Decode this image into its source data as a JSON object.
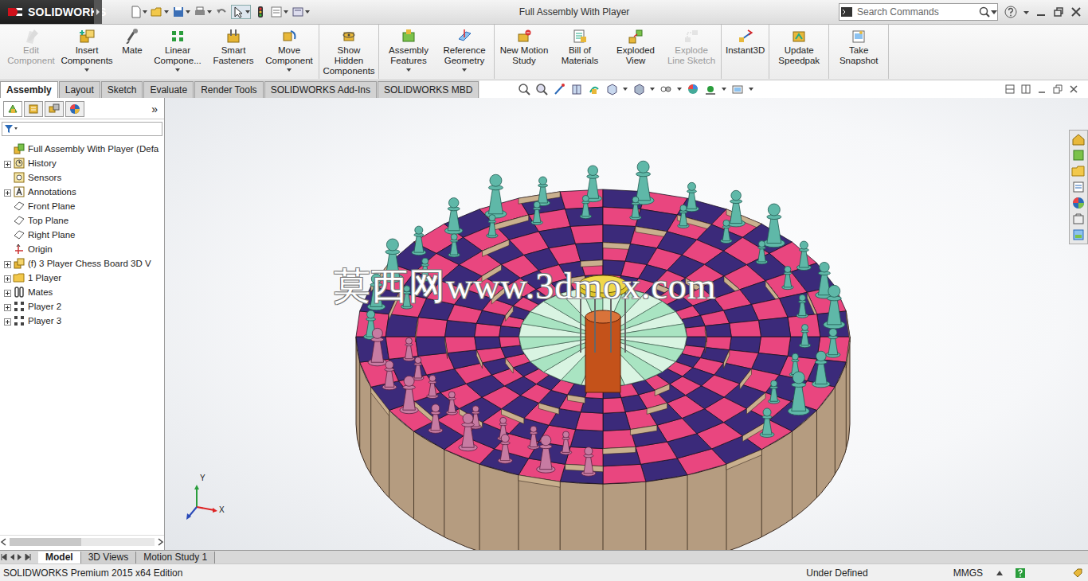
{
  "app": {
    "logo": "SOLIDWORKS",
    "title": "Full Assembly With Player"
  },
  "search": {
    "placeholder": "Search Commands"
  },
  "command_groups": [
    [
      {
        "label": "Edit Component",
        "disabled": true,
        "menu": false
      },
      {
        "label": "Insert Components",
        "disabled": false,
        "menu": true
      },
      {
        "label": "Mate",
        "disabled": false,
        "menu": false
      },
      {
        "label": "Linear Compone...",
        "disabled": false,
        "menu": true
      },
      {
        "label": "Smart Fasteners",
        "disabled": false,
        "menu": false
      },
      {
        "label": "Move Component",
        "disabled": false,
        "menu": true
      }
    ],
    [
      {
        "label": "Show Hidden Components",
        "disabled": false,
        "menu": false
      }
    ],
    [
      {
        "label": "Assembly Features",
        "disabled": false,
        "menu": true
      },
      {
        "label": "Reference Geometry",
        "disabled": false,
        "menu": true
      }
    ],
    [
      {
        "label": "New Motion Study",
        "disabled": false,
        "menu": false
      },
      {
        "label": "Bill of Materials",
        "disabled": false,
        "menu": false
      },
      {
        "label": "Exploded View",
        "disabled": false,
        "menu": false
      },
      {
        "label": "Explode Line Sketch",
        "disabled": true,
        "menu": false
      }
    ],
    [
      {
        "label": "Instant3D",
        "disabled": false,
        "menu": false
      }
    ],
    [
      {
        "label": "Update Speedpak",
        "disabled": false,
        "menu": false
      }
    ],
    [
      {
        "label": "Take Snapshot",
        "disabled": false,
        "menu": false
      }
    ]
  ],
  "tabs": [
    {
      "label": "Assembly",
      "selected": true
    },
    {
      "label": "Layout",
      "selected": false
    },
    {
      "label": "Sketch",
      "selected": false
    },
    {
      "label": "Evaluate",
      "selected": false
    },
    {
      "label": "Render Tools",
      "selected": false
    },
    {
      "label": "SOLIDWORKS Add-Ins",
      "selected": false
    },
    {
      "label": "SOLIDWORKS MBD",
      "selected": false
    }
  ],
  "panel": {
    "more": "»"
  },
  "tree": {
    "items": [
      {
        "label": "Full Assembly With Player  (Defa",
        "expandable": false
      },
      {
        "label": "History",
        "expandable": true
      },
      {
        "label": "Sensors",
        "expandable": false
      },
      {
        "label": "Annotations",
        "expandable": true
      },
      {
        "label": "Front Plane",
        "expandable": false
      },
      {
        "label": "Top Plane",
        "expandable": false
      },
      {
        "label": "Right Plane",
        "expandable": false
      },
      {
        "label": "Origin",
        "expandable": false
      },
      {
        "label": "(f) 3 Player Chess Board 3D V",
        "expandable": true
      },
      {
        "label": "1 Player",
        "expandable": true
      },
      {
        "label": "Mates",
        "expandable": true
      },
      {
        "label": "Player 2",
        "expandable": true
      },
      {
        "label": "Player 3",
        "expandable": true
      }
    ]
  },
  "viewport": {
    "watermark": "莫西网www.3dmox.com",
    "axis_y": "Y",
    "axis_x": "X"
  },
  "bottom_tabs": [
    {
      "label": "Model",
      "selected": true
    },
    {
      "label": "3D Views",
      "selected": false
    },
    {
      "label": "Motion Study 1",
      "selected": false
    }
  ],
  "status_bar": {
    "edition": "SOLIDWORKS Premium 2015 x64 Edition",
    "state": "Under Defined",
    "units": "MMGS"
  }
}
